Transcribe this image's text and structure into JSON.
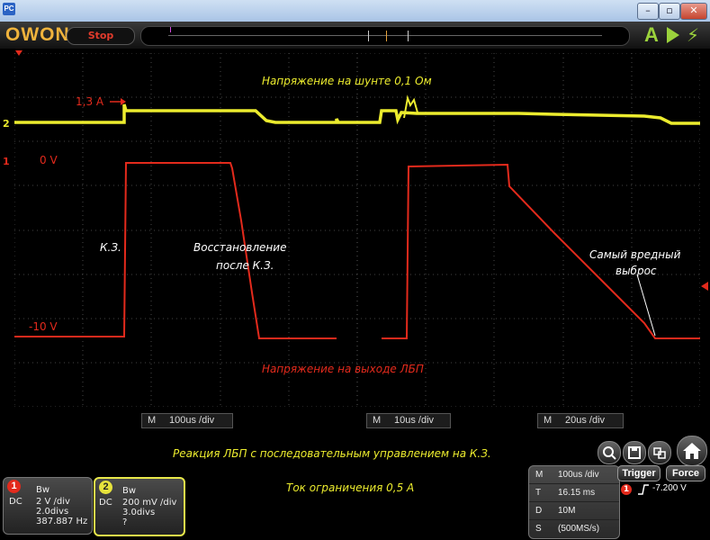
{
  "window": {
    "app_icon": "PC",
    "controls": {
      "minimize": "–",
      "restore": "▫",
      "close": "✕"
    }
  },
  "toolbar": {
    "logo": "OWON",
    "stop_label": "Stop",
    "mode_label": "A",
    "icons": [
      "run-icon",
      "power-icon"
    ]
  },
  "annotations": {
    "shunt_title": "Напряжение на шунте  0,1 Ом",
    "current_level": "1,3 А",
    "zero_volt": "0 V",
    "minus_ten": "-10 V",
    "short_circuit": "К.З.",
    "recovery_line1": "Восстановление",
    "recovery_line2": "после К.З.",
    "worst_line1": "Самый вредный",
    "worst_line2": "выброс",
    "output_title": "Напряжение на выходе ЛБП",
    "bottom_line1": "Реакция ЛБП с последовательным управлением на К.З.",
    "bottom_line2": "Ток ограничения 0,5 А"
  },
  "timebases": [
    {
      "m": "M",
      "value": "100us /div"
    },
    {
      "m": "M",
      "value": "10us /div"
    },
    {
      "m": "M",
      "value": "20us /div"
    }
  ],
  "channels": {
    "ch1": {
      "num": "1",
      "bw": "Bw",
      "coupling": "DC",
      "scale": "2 V /div",
      "offset": "2.0divs",
      "freq": "387.887 Hz"
    },
    "ch2": {
      "num": "2",
      "bw": "Bw",
      "coupling": "DC",
      "scale": "200 mV /div",
      "offset": "3.0divs",
      "freq": "?"
    }
  },
  "acquisition": {
    "rows": [
      {
        "k": "M",
        "v": "100us /div"
      },
      {
        "k": "T",
        "v": "16.15 ms"
      },
      {
        "k": "D",
        "v": "10M"
      },
      {
        "k": "S",
        "v": "(500MS/s)"
      }
    ]
  },
  "trigger": {
    "trigger_label": "Trigger",
    "force_label": "Force",
    "level": "-7.200 V",
    "source": "1"
  },
  "markers": {
    "ch2": "2",
    "ch1": "1"
  },
  "colors": {
    "ch1": "#e32a1c",
    "ch2": "#ecec2e",
    "grid": "#5a5a5a",
    "logo": "#f0b33c",
    "accent": "#9bd23c"
  }
}
